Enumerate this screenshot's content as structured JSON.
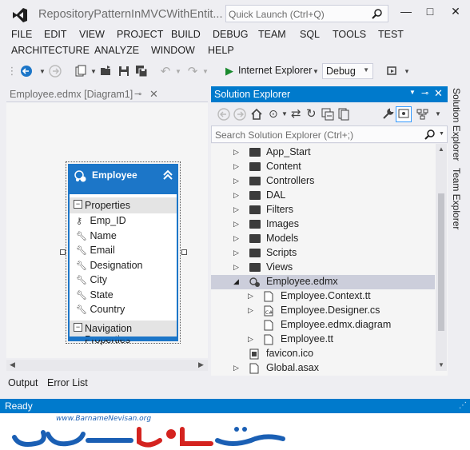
{
  "window": {
    "title": "RepositoryPatternInMVCWithEntit...",
    "quick_launch_placeholder": "Quick Launch (Ctrl+Q)",
    "minimize_glyph": "—",
    "restore_glyph": "□",
    "close_glyph": "✕"
  },
  "menu_row1": [
    "FILE",
    "EDIT",
    "VIEW",
    "PROJECT",
    "BUILD",
    "DEBUG",
    "TEAM",
    "SQL",
    "TOOLS",
    "TEST"
  ],
  "menu_row2": [
    "ARCHITECTURE",
    "ANALYZE",
    "WINDOW",
    "HELP"
  ],
  "toolbar": {
    "run_label": "Internet Explorer",
    "config_value": "Debug"
  },
  "document_tab": {
    "label": "Employee.edmx [Diagram1]"
  },
  "entity": {
    "name": "Employee",
    "properties_label": "Properties",
    "properties": [
      "Emp_ID",
      "Name",
      "Email",
      "Designation",
      "City",
      "State",
      "Country"
    ],
    "navigation_label": "Navigation Properties"
  },
  "solution_explorer": {
    "title": "Solution Explorer",
    "search_placeholder": "Search Solution Explorer (Ctrl+;)",
    "items": [
      {
        "label": "App_Start",
        "kind": "folder",
        "expanded": false,
        "selected": false
      },
      {
        "label": "Content",
        "kind": "folder",
        "expanded": false,
        "selected": false
      },
      {
        "label": "Controllers",
        "kind": "folder",
        "expanded": false,
        "selected": false
      },
      {
        "label": "DAL",
        "kind": "folder",
        "expanded": false,
        "selected": false
      },
      {
        "label": "Filters",
        "kind": "folder",
        "expanded": false,
        "selected": false
      },
      {
        "label": "Images",
        "kind": "folder",
        "expanded": false,
        "selected": false
      },
      {
        "label": "Models",
        "kind": "folder",
        "expanded": false,
        "selected": false
      },
      {
        "label": "Scripts",
        "kind": "folder",
        "expanded": false,
        "selected": false
      },
      {
        "label": "Views",
        "kind": "folder",
        "expanded": false,
        "selected": false
      },
      {
        "label": "Employee.edmx",
        "kind": "edmx",
        "expanded": true,
        "selected": true
      },
      {
        "label": "Employee.Context.tt",
        "kind": "file",
        "expanded": false,
        "selected": false
      },
      {
        "label": "Employee.Designer.cs",
        "kind": "file",
        "expanded": false,
        "selected": false
      },
      {
        "label": "Employee.edmx.diagram",
        "kind": "file",
        "expanded": null,
        "selected": false
      },
      {
        "label": "Employee.tt",
        "kind": "file",
        "expanded": false,
        "selected": false
      },
      {
        "label": "favicon.ico",
        "kind": "file",
        "expanded": null,
        "selected": false
      },
      {
        "label": "Global.asax",
        "kind": "file",
        "expanded": false,
        "selected": false
      }
    ]
  },
  "side_tabs": [
    "Solution Explorer",
    "Team Explorer"
  ],
  "bottom_tabs": [
    "Output",
    "Error List"
  ],
  "status": {
    "text": "Ready"
  },
  "watermark": {
    "url": "www.BarnameNevisan.org",
    "logo_text": "برنامه نویسان"
  },
  "colors": {
    "accent": "#007acc",
    "entity_header": "#1c76c8",
    "chrome": "#eeeef2",
    "logo_blue": "#1a5fb4",
    "logo_red": "#d4231f"
  }
}
